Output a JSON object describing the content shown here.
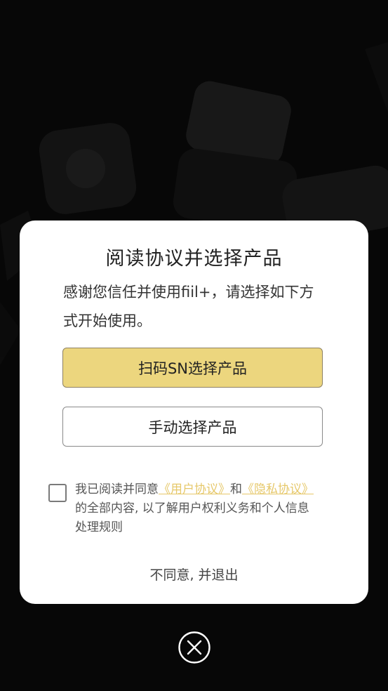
{
  "dialog": {
    "title": "阅读协议并选择产品",
    "description": "感谢您信任并使用fiil+，请选择如下方式开始使用。",
    "scan_button_label": "扫码SN选择产品",
    "manual_button_label": "手动选择产品",
    "consent": {
      "prefix": "我已阅读并同意",
      "user_agreement_link": "《用户协议》",
      "connector": "和",
      "privacy_link": "《隐私协议》",
      "suffix": "的全部内容, 以了解用户权利义务和个人信息处理规则",
      "checked": false
    },
    "decline_label": "不同意, 并退出"
  },
  "colors": {
    "primary_button": "#ecd67e",
    "link": "#e6c86a",
    "backdrop": "#070707"
  },
  "icons": {
    "close": "close-circle-icon"
  }
}
